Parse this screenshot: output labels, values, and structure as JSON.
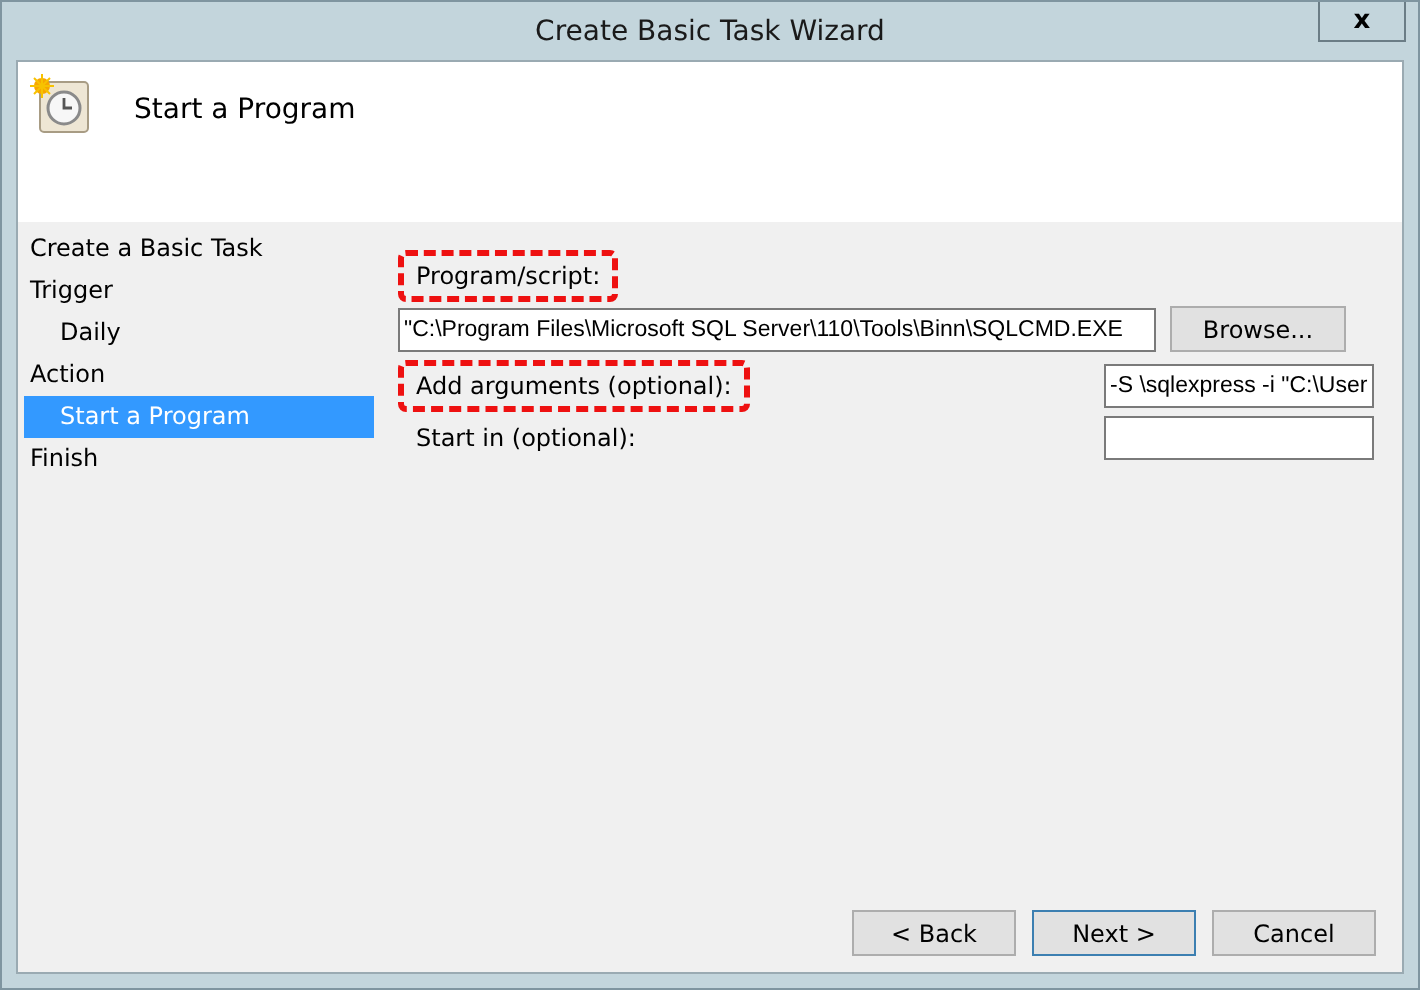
{
  "window": {
    "title": "Create Basic Task Wizard",
    "close": "x"
  },
  "header": {
    "title": "Start a Program"
  },
  "steps": [
    {
      "label": "Create a Basic Task",
      "selected": false
    },
    {
      "label": "Trigger",
      "selected": false,
      "children": [
        {
          "label": "Daily",
          "selected": false
        }
      ]
    },
    {
      "label": "Action",
      "selected": false,
      "children": [
        {
          "label": "Start a Program",
          "selected": true
        }
      ]
    },
    {
      "label": "Finish",
      "selected": false
    }
  ],
  "form": {
    "program": {
      "label": "Program/script:",
      "highlighted": true,
      "value": "\"C:\\Program Files\\Microsoft SQL Server\\110\\Tools\\Binn\\SQLCMD.EXE",
      "browse": "Browse..."
    },
    "arguments": {
      "label": "Add arguments (optional):",
      "highlighted": true,
      "value": "-S \\sqlexpress -i \"C:\\User"
    },
    "start_in": {
      "label": "Start in (optional):",
      "highlighted": false
    }
  },
  "buttons": [
    {
      "label": "< Back",
      "default": false
    },
    {
      "label": "Next >",
      "default": true
    },
    {
      "label": "Cancel",
      "default": false
    }
  ]
}
